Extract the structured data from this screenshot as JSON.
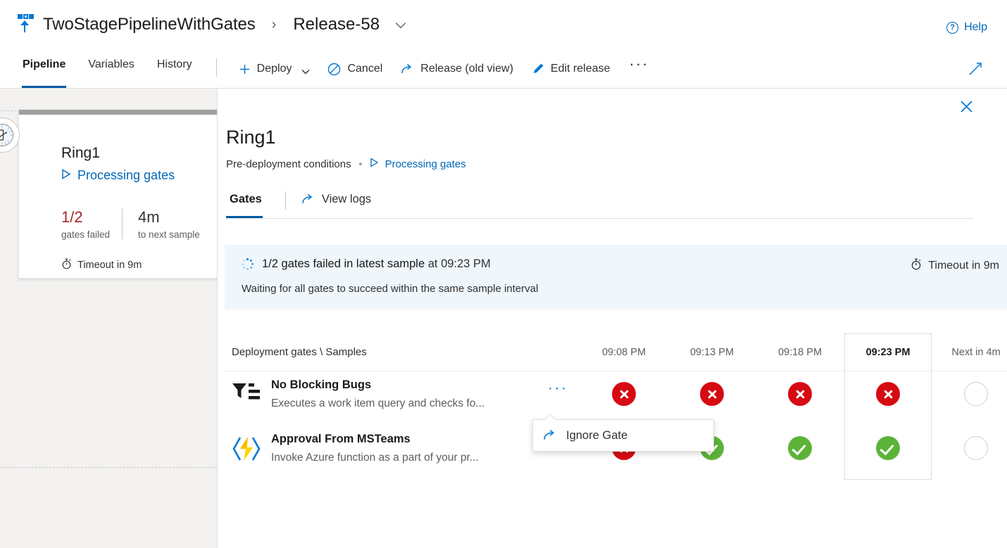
{
  "header": {
    "logo_icon": "release-pipeline-icon",
    "pipeline_name": "TwoStagePipelineWithGates",
    "breadcrumb_separator": "›",
    "release_name": "Release-58",
    "release_dropdown_icon": "chevron-down-icon",
    "help_label": "Help",
    "help_icon": "question-circle-icon"
  },
  "toolbar": {
    "tabs": [
      {
        "label": "Pipeline",
        "selected": true
      },
      {
        "label": "Variables",
        "selected": false
      },
      {
        "label": "History",
        "selected": false
      }
    ],
    "actions": [
      {
        "label": "Deploy",
        "icon": "plus-icon",
        "has_chevron": true
      },
      {
        "label": "Cancel",
        "icon": "cancel-circle-icon",
        "has_chevron": false
      },
      {
        "label": "Release (old view)",
        "icon": "external-link-icon",
        "has_chevron": false
      },
      {
        "label": "Edit release",
        "icon": "pencil-icon",
        "has_chevron": false
      }
    ],
    "overflow_label": "···",
    "expand_icon": "expand-diagonal-icon"
  },
  "stage_card": {
    "badge_icon": "gates-clock-icon",
    "name": "Ring1",
    "status_icon": "play-triangle-icon",
    "status_label": "Processing gates",
    "metrics": [
      {
        "value": "1/2",
        "label": "gates failed",
        "tone": "red"
      },
      {
        "value": "4m",
        "label": "to next sample",
        "tone": "gray"
      }
    ],
    "timeout_icon": "stopwatch-icon",
    "timeout_label": "Timeout in 9m"
  },
  "panel": {
    "close_icon": "close-icon",
    "title": "Ring1",
    "subtitle": "Pre-deployment conditions",
    "subtitle_link_icon": "play-triangle-icon",
    "subtitle_link": "Processing gates",
    "tabs": {
      "gates_label": "Gates",
      "view_logs_icon": "external-link-icon",
      "view_logs_label": "View logs"
    },
    "banner": {
      "spinner_icon": "loading-spinner-icon",
      "headline_strong": "1/2 gates failed in latest sample",
      "headline_rest": " at 09:23 PM",
      "subtext": "Waiting for all gates to succeed within the same sample interval",
      "timeout_icon": "stopwatch-icon",
      "timeout_label": "Timeout in 9m",
      "background_color": "#eff6fc"
    },
    "table": {
      "row_header_label": "Deployment gates \\ Samples",
      "columns": [
        {
          "label": "09:08 PM",
          "highlighted": false
        },
        {
          "label": "09:13 PM",
          "highlighted": false
        },
        {
          "label": "09:18 PM",
          "highlighted": false
        },
        {
          "label": "09:23 PM",
          "highlighted": true
        },
        {
          "label": "Next in 4m",
          "highlighted": false
        }
      ],
      "rows": [
        {
          "icon": "work-item-query-filter-icon",
          "title": "No Blocking Bugs",
          "description": "Executes a work item query and checks fo...",
          "more_label": "···",
          "samples": [
            "fail",
            "fail",
            "fail",
            "fail",
            "pending"
          ]
        },
        {
          "icon": "azure-function-icon",
          "title": "Approval From MSTeams",
          "description": "Invoke Azure function as a part of your pr...",
          "more_label": "",
          "samples": [
            "fail",
            "pass",
            "pass",
            "pass",
            "pending"
          ]
        }
      ]
    },
    "context_menu": {
      "icon": "external-link-icon",
      "label": "Ignore Gate"
    }
  },
  "colors": {
    "accent": "#0078d4",
    "link": "#0067b8",
    "fail": "#d60b12",
    "pass": "#5cb338",
    "pending_ring": "#d2d0ce",
    "red_text": "#a4262c",
    "canvas": "#f3f2f1"
  }
}
